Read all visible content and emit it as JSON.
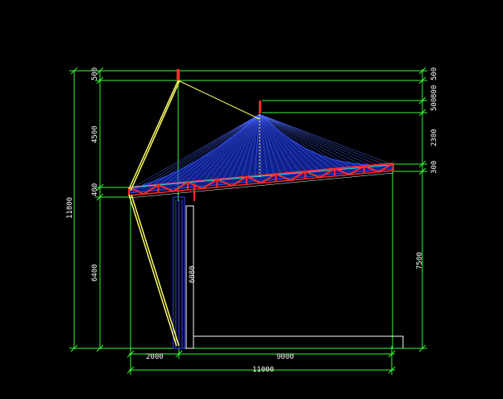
{
  "drawing": {
    "background": "#000000",
    "colors": {
      "dimension": "#33ff33",
      "text": "#ffffff",
      "membrane": "#1f3dff",
      "truss": "#ff2a2a",
      "cable": "#ffff66",
      "mast": "#3344ff",
      "outline": "#ffffff",
      "cyan": "#00e5ff"
    },
    "dimensions_left": {
      "d500": "500",
      "d4500": "4500",
      "d400": "400",
      "d6400": "6400",
      "total": "11800"
    },
    "dimensions_right": {
      "d500": "500",
      "d800": "800",
      "d500b": "500",
      "d2300": "2300",
      "d300": "300",
      "d7500": "7500"
    },
    "dimensions_bottom": {
      "d2000": "2000",
      "d9000": "9000",
      "total": "11000"
    },
    "column_label": "6080"
  }
}
